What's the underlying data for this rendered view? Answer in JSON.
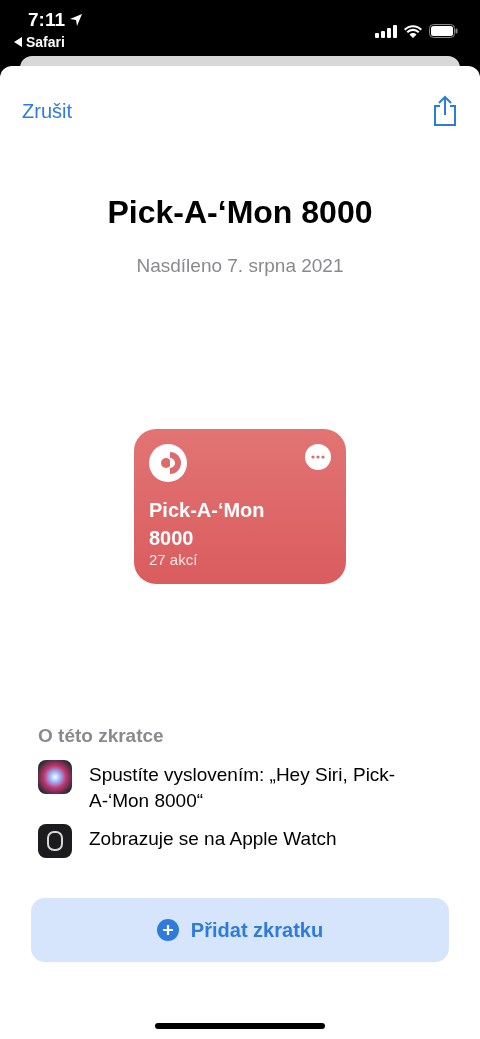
{
  "status_bar": {
    "time": "7:11",
    "back_app": "Safari"
  },
  "nav": {
    "cancel": "Zrušit"
  },
  "title": "Pick-A-‘Mon 8000",
  "subtitle": "Nasdíleno 7. srpna 2021",
  "card": {
    "name": "Pick-A-‘Mon 8000",
    "actions": "27 akcí"
  },
  "about": {
    "heading": "O této zkratce",
    "items": [
      {
        "kind": "siri",
        "text": "Spustíte vyslovením: „Hey Siri, Pick-A-‘Mon 8000“"
      },
      {
        "kind": "watch",
        "text": "Zobrazuje se na Apple Watch"
      }
    ]
  },
  "add_button": {
    "label": "Přidat zkratku"
  }
}
